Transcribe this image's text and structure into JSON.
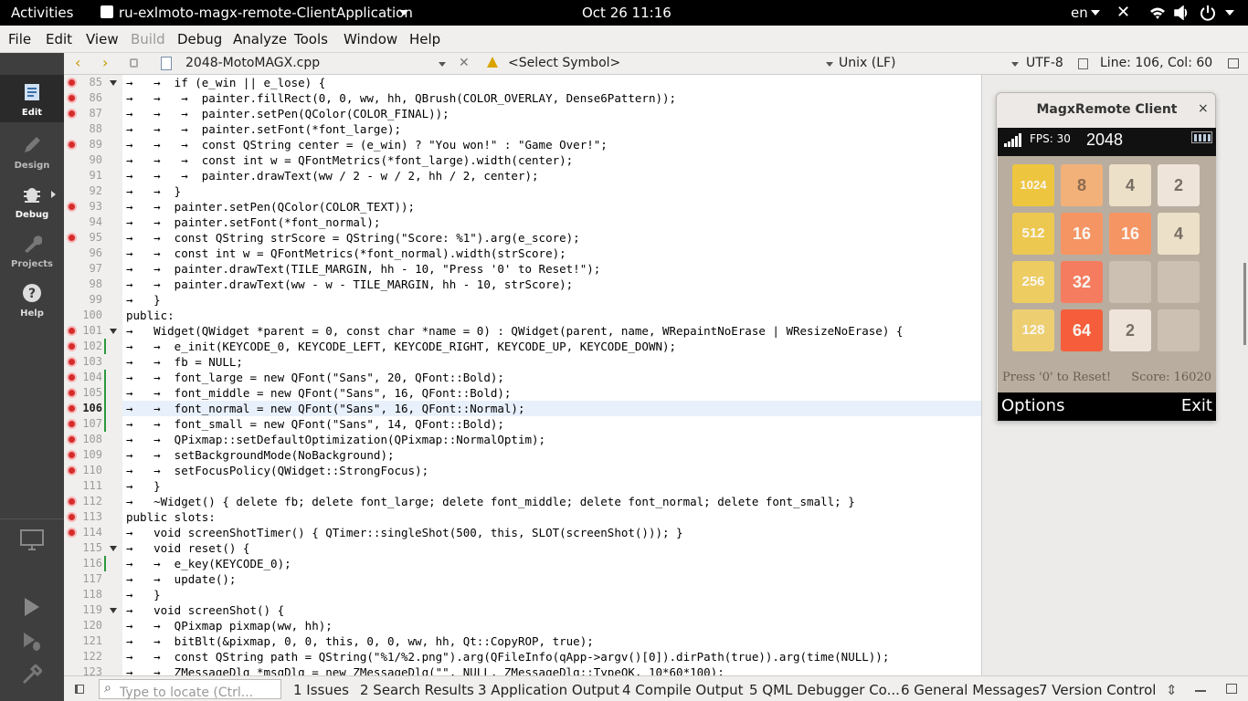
{
  "topbar": {
    "activities": "Activities",
    "app_name": "ru-exlmoto-magx-remote-ClientApplication",
    "datetime": "Oct 26  11:16",
    "lang": "en"
  },
  "menu": [
    "File",
    "Edit",
    "View",
    "Build",
    "Debug",
    "Analyze",
    "Tools",
    "Window",
    "Help"
  ],
  "modes": [
    {
      "label": "Edit",
      "active": true
    },
    {
      "label": "Design",
      "active": false
    },
    {
      "label": "Debug",
      "active": false
    },
    {
      "label": "Projects",
      "active": false
    },
    {
      "label": "Help",
      "active": false
    }
  ],
  "editor": {
    "filename": "2048-MotoMAGX.cpp",
    "symbol": "<Select Symbol>",
    "line_ending": "Unix (LF)",
    "encoding": "UTF-8",
    "position": "Line: 106, Col: 60"
  },
  "code": {
    "current_line": 106,
    "lines": [
      {
        "n": 85,
        "t": "→   →  if (e_win || e_lose) {",
        "bp": true,
        "fold": true
      },
      {
        "n": 86,
        "t": "→   →   →  painter.fillRect(0, 0, ww, hh, QBrush(COLOR_OVERLAY, Dense6Pattern));",
        "bp": true
      },
      {
        "n": 87,
        "t": "→   →   →  painter.setPen(QColor(COLOR_FINAL));",
        "bp": true
      },
      {
        "n": 88,
        "t": "→   →   →  painter.setFont(*font_large);",
        "bp": false
      },
      {
        "n": 89,
        "t": "→   →   →  const QString center = (e_win) ? \"You won!\" : \"Game Over!\";",
        "bp": true
      },
      {
        "n": 90,
        "t": "→   →   →  const int w = QFontMetrics(*font_large).width(center);",
        "bp": false
      },
      {
        "n": 91,
        "t": "→   →   →  painter.drawText(ww / 2 - w / 2, hh / 2, center);",
        "bp": false
      },
      {
        "n": 92,
        "t": "→   →  }",
        "bp": false
      },
      {
        "n": 93,
        "t": "→   →  painter.setPen(QColor(COLOR_TEXT));",
        "bp": true
      },
      {
        "n": 94,
        "t": "→   →  painter.setFont(*font_normal);",
        "bp": false
      },
      {
        "n": 95,
        "t": "→   →  const QString strScore = QString(\"Score: %1\").arg(e_score);",
        "bp": true
      },
      {
        "n": 96,
        "t": "→   →  const int w = QFontMetrics(*font_normal).width(strScore);",
        "bp": false
      },
      {
        "n": 97,
        "t": "→   →  painter.drawText(TILE_MARGIN, hh - 10, \"Press '0' to Reset!\");",
        "bp": false
      },
      {
        "n": 98,
        "t": "→   →  painter.drawText(ww - w - TILE_MARGIN, hh - 10, strScore);",
        "bp": false
      },
      {
        "n": 99,
        "t": "→   }",
        "bp": false
      },
      {
        "n": 100,
        "t": "public:",
        "bp": false
      },
      {
        "n": 101,
        "t": "→   Widget(QWidget *parent = 0, const char *name = 0) : QWidget(parent, name, WRepaintNoErase | WResizeNoErase) {",
        "bp": true,
        "fold": true
      },
      {
        "n": 102,
        "t": "→   →  e_init(KEYCODE_0, KEYCODE_LEFT, KEYCODE_RIGHT, KEYCODE_UP, KEYCODE_DOWN);",
        "bp": true,
        "chg": true
      },
      {
        "n": 103,
        "t": "→   →  fb = NULL;",
        "bp": true
      },
      {
        "n": 104,
        "t": "→   →  font_large = new QFont(\"Sans\", 20, QFont::Bold);",
        "bp": true,
        "chg": true
      },
      {
        "n": 105,
        "t": "→   →  font_middle = new QFont(\"Sans\", 16, QFont::Bold);",
        "bp": true,
        "chg": true
      },
      {
        "n": 106,
        "t": "→   →  font_normal = new QFont(\"Sans\", 16, QFont::Normal);",
        "bp": true,
        "chg": true
      },
      {
        "n": 107,
        "t": "→   →  font_small = new QFont(\"Sans\", 14, QFont::Bold);",
        "bp": true,
        "chg": true
      },
      {
        "n": 108,
        "t": "→   →  QPixmap::setDefaultOptimization(QPixmap::NormalOptim);",
        "bp": true
      },
      {
        "n": 109,
        "t": "→   →  setBackgroundMode(NoBackground);",
        "bp": true
      },
      {
        "n": 110,
        "t": "→   →  setFocusPolicy(QWidget::StrongFocus);",
        "bp": true
      },
      {
        "n": 111,
        "t": "→   }",
        "bp": false
      },
      {
        "n": 112,
        "t": "→   ~Widget() { delete fb; delete font_large; delete font_middle; delete font_normal; delete font_small; }",
        "bp": true
      },
      {
        "n": 113,
        "t": "public slots:",
        "bp": true
      },
      {
        "n": 114,
        "t": "→   void screenShotTimer() { QTimer::singleShot(500, this, SLOT(screenShot())); }",
        "bp": true
      },
      {
        "n": 115,
        "t": "→   void reset() {",
        "bp": false,
        "fold": true
      },
      {
        "n": 116,
        "t": "→   →  e_key(KEYCODE_0);",
        "bp": false,
        "chg": true
      },
      {
        "n": 117,
        "t": "→   →  update();",
        "bp": false
      },
      {
        "n": 118,
        "t": "→   }",
        "bp": false
      },
      {
        "n": 119,
        "t": "→   void screenShot() {",
        "bp": false,
        "fold": true
      },
      {
        "n": 120,
        "t": "→   →  QPixmap pixmap(ww, hh);",
        "bp": false
      },
      {
        "n": 121,
        "t": "→   →  bitBlt(&pixmap, 0, 0, this, 0, 0, ww, hh, Qt::CopyROP, true);",
        "bp": false
      },
      {
        "n": 122,
        "t": "→   →  const QString path = QString(\"%1/%2.png\").arg(QFileInfo(qApp->argv()[0]).dirPath(true)).arg(time(NULL));",
        "bp": false
      },
      {
        "n": 123,
        "t": "→   →  ZMessageDlg *msgDlg = new ZMessageDlg(\"\", NULL, ZMessageDlg::TypeOK, 10*60*100);",
        "bp": false
      }
    ]
  },
  "bottom": {
    "locate_placeholder": "Type to locate (Ctrl...",
    "tabs": [
      "1  Issues",
      "2  Search Results",
      "3  Application Output",
      "4  Compile Output",
      "5  QML Debugger Co...",
      "6  General Messages",
      "7  Version Control"
    ]
  },
  "magx": {
    "title": "MagxRemote Client",
    "close": "×",
    "fps": "FPS: 30",
    "app_title": "2048",
    "grid": [
      [
        "1024",
        "8",
        "4",
        "2"
      ],
      [
        "512",
        "16",
        "16",
        "4"
      ],
      [
        "256",
        "32",
        "",
        ""
      ],
      [
        "128",
        "64",
        "2",
        ""
      ]
    ],
    "reset_hint": "Press '0' to Reset!",
    "score": "Score: 16020",
    "soft_left": "Options",
    "soft_right": "Exit",
    "tile_colors": {
      "": "#ccc0b3",
      "2": "#eee4da",
      "4": "#ede0c8",
      "8": "#f2b179",
      "16": "#f59563",
      "32": "#f67c5f",
      "64": "#f65e3b",
      "128": "#edcf72",
      "256": "#edcc61",
      "512": "#edc850",
      "1024": "#edc53f"
    }
  }
}
